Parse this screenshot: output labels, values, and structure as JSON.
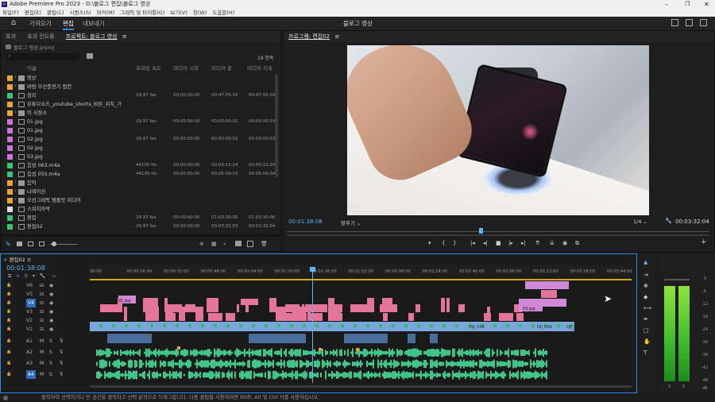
{
  "app": {
    "title": "Adobe Premiere Pro 2023 - D:\\블로그 편집\\블로그 영상",
    "center_title": "블로그 영상"
  },
  "menu": [
    "파일(F)",
    "편집(E)",
    "클립(C)",
    "시퀀스(S)",
    "마커(M)",
    "그래픽 및 타이틀(G)",
    "보기(V)",
    "창(W)",
    "도움말(H)"
  ],
  "workspace": {
    "tabs": [
      "가져오기",
      "편집",
      "내보내기"
    ],
    "active": "편집"
  },
  "project": {
    "tabs": [
      "효과",
      "효과 컨트롤",
      "프로젝트: 블로그 영상"
    ],
    "file": "블로그 영상.prproj",
    "count": "19 항목",
    "columns": [
      "이름",
      "프레임 속도",
      "미디어 시작",
      "미디어 끝",
      "미디어 지속"
    ],
    "items": [
      {
        "name": "영상",
        "type": "folder",
        "color": "#e8a33a",
        "fps": "",
        "start": "",
        "end": "",
        "dur": ""
      },
      {
        "name": "바람 무선충전기 법칸",
        "type": "folder",
        "color": "#e8a33a",
        "fps": "",
        "start": "",
        "end": "",
        "dur": ""
      },
      {
        "name": "정리",
        "type": "seq",
        "color": "#38c472",
        "fps": "29.97 fps",
        "start": "00:00:00:00",
        "end": "00:47:55:15",
        "dur": "00:47:55:16"
      },
      {
        "name": "뮤튜브쇼츠_youtube_shorts_바튼_위치_가",
        "type": "file",
        "color": "#e8a33a",
        "fps": "",
        "start": "",
        "end": "",
        "dur": ""
      },
      {
        "name": "이 저장소",
        "type": "folder",
        "color": "#e8a33a",
        "fps": "",
        "start": "",
        "end": "",
        "dur": ""
      },
      {
        "name": "01.jpg",
        "type": "img",
        "color": "#c876d8",
        "fps": "29.97 fps",
        "start": "00:00:00:00",
        "end": "00:00:00:02",
        "dur": "00:00:00:03"
      },
      {
        "name": "01.jpg",
        "type": "img",
        "color": "#c876d8",
        "fps": "",
        "start": "",
        "end": "",
        "dur": ""
      },
      {
        "name": "02.jpg",
        "type": "img",
        "color": "#c876d8",
        "fps": "29.97 fps",
        "start": "00:00:00:00",
        "end": "00:00:00:02",
        "dur": "00:00:00:03"
      },
      {
        "name": "02.jpg",
        "type": "img",
        "color": "#c876d8",
        "fps": "",
        "start": "",
        "end": "",
        "dur": ""
      },
      {
        "name": "03.jpg",
        "type": "img",
        "color": "#c876d8",
        "fps": "",
        "start": "",
        "end": "",
        "dur": ""
      },
      {
        "name": "음성 063.m4a",
        "type": "audio",
        "color": "#38c472",
        "fps": "44100 Hz",
        "start": "00:00:00:00",
        "end": "00:00:15:24",
        "dur": "00:00:15:25"
      },
      {
        "name": "음성 055.m4a",
        "type": "audio",
        "color": "#38c472",
        "fps": "44100 Hz",
        "start": "00:00:00:00",
        "end": "00:05:09:03",
        "dur": "00:05:09:04"
      },
      {
        "name": "음악",
        "type": "folder",
        "color": "#e8a33a",
        "fps": "",
        "start": "",
        "end": "",
        "dur": ""
      },
      {
        "name": "나레이션",
        "type": "folder",
        "color": "#e8a33a",
        "fps": "",
        "start": "",
        "end": "",
        "dur": ""
      },
      {
        "name": "모션그래픽 템플릿 미디어",
        "type": "folder",
        "color": "#e8a33a",
        "fps": "",
        "start": "",
        "end": "",
        "dur": ""
      },
      {
        "name": "스위치자막",
        "type": "file",
        "color": "#dddddd",
        "fps": "",
        "start": "",
        "end": "",
        "dur": ""
      },
      {
        "name": "편집",
        "type": "seq",
        "color": "#38c472",
        "fps": "29.97 fps",
        "start": "00:00:00:00",
        "end": "01:03:30:05",
        "dur": "01:03:30:06"
      },
      {
        "name": "편집02",
        "type": "seq",
        "color": "#38c472",
        "fps": "29.97 fps",
        "start": "00:00:00:00",
        "end": "00:03:32:03",
        "dur": "00:03:32:04"
      }
    ]
  },
  "program": {
    "title": "프로그램: 편집02",
    "timecode": "00:01:38:08",
    "fit": "맞추기",
    "quality": "1/4",
    "duration": "00:03:32:04"
  },
  "timeline": {
    "tab": "편집02",
    "timecode": "00:01:38:08",
    "ruler": [
      "00:00",
      "00:00:16:00",
      "00:00:32:00",
      "00:00:48:00",
      "00:01:04:00",
      "00:01:20:00",
      "00:01:36:00",
      "00:01:52:00",
      "00:02:08:00",
      "00:02:24:00",
      "00:02:40:00",
      "00:02:56:00",
      "00:03:12:00",
      "00:03:28:00",
      "00:03:44:00"
    ],
    "video_tracks": [
      "V6",
      "V5",
      "V4",
      "V3",
      "V2",
      "V1"
    ],
    "audio_tracks": [
      "A1",
      "A2",
      "A3",
      "A4"
    ],
    "clip_labels": [
      "01.jpg",
      "03.jpg",
      "DJI_034",
      "DJI_034",
      "DJI_0342.M",
      "02.jpg"
    ]
  },
  "meter": {
    "scale": [
      "0",
      "-6",
      "-12",
      "-18",
      "-24",
      "-30",
      "-36",
      "-42",
      "-48",
      "dB"
    ],
    "lr": [
      "S",
      "S"
    ]
  },
  "status": "클릭하여 선택하거나 빈 공간을 클릭하고 선택 윤곽으로 드래그합니다. 다중 클립을 사용하려면 Shift, Alt 및 Ctrl 키를 사용하십시오.",
  "colors": {
    "accent": "#2d8ceb",
    "video_clip": "#e3749a",
    "v1": "#7aa6dc",
    "audio": "#3fc48a"
  }
}
